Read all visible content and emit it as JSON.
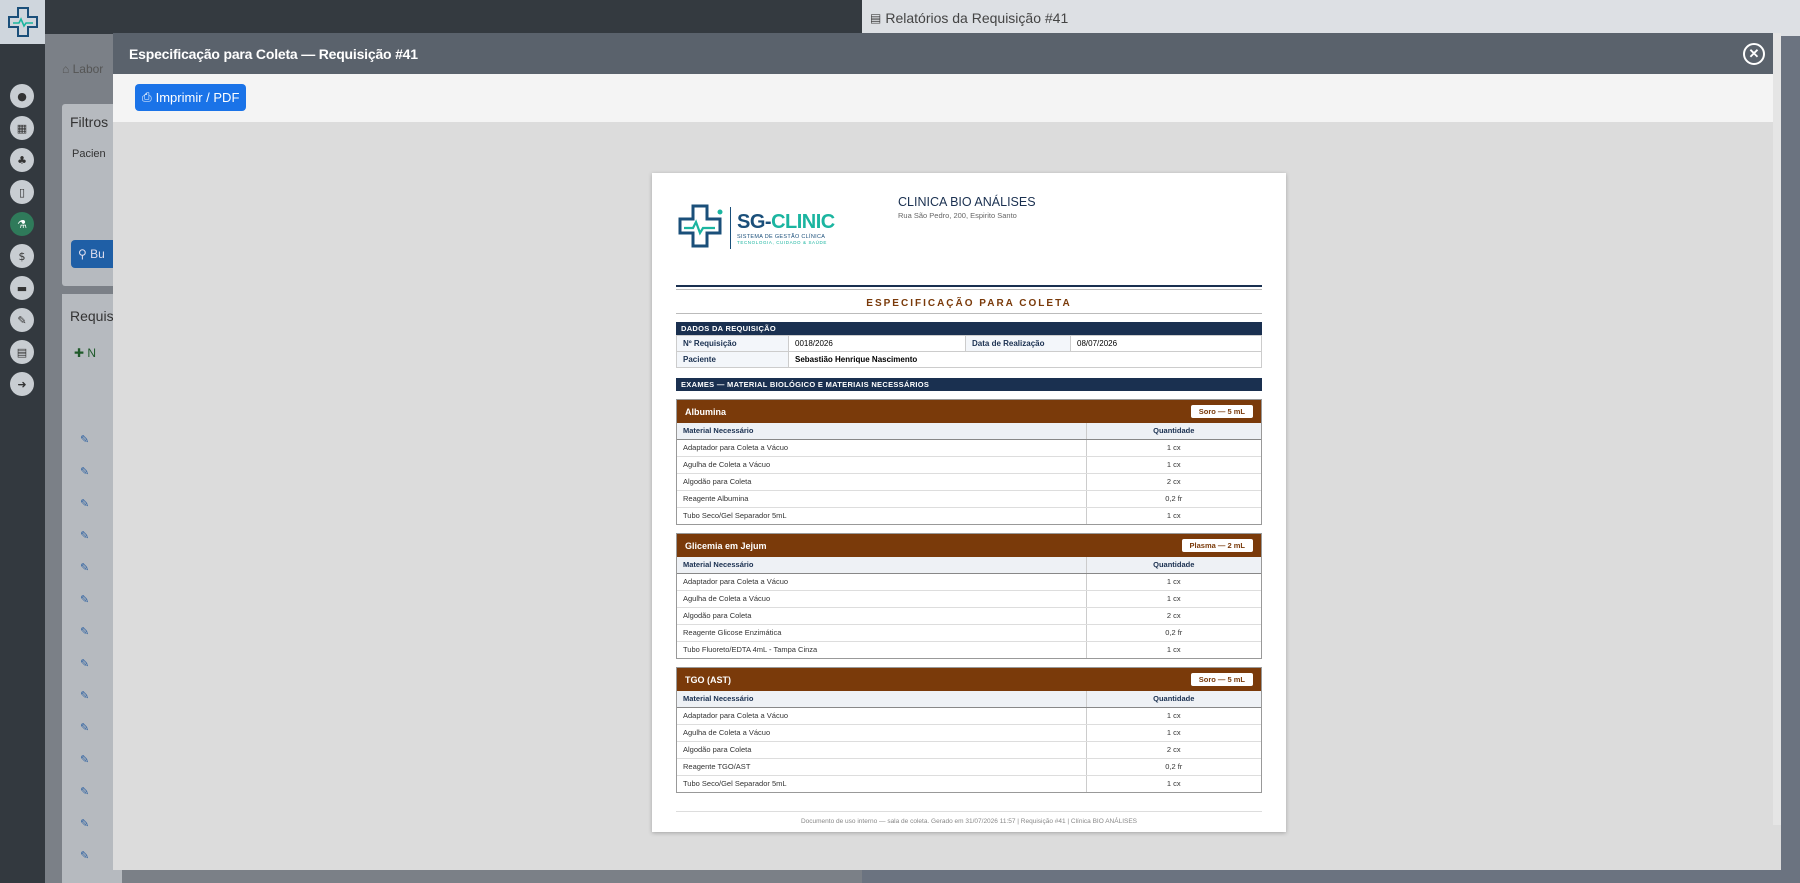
{
  "background": {
    "report_header": "Relatórios da Requisição #41",
    "breadcrumb": "Labor",
    "filters_title": "Filtros",
    "filter_label": "Pacien",
    "search_btn": "Bu",
    "list_title": "Requis",
    "new_btn": "N",
    "sidebar_icons": [
      "user-icon",
      "calendar-icon",
      "users-icon",
      "clipboard-icon",
      "microscope-icon",
      "dollar-icon",
      "archive-icon",
      "edit-icon",
      "file-icon",
      "logout-icon"
    ]
  },
  "modal": {
    "title": "Especificação para Coleta — Requisição #41",
    "close_icon": "close-icon",
    "print_label": "Imprimir / PDF"
  },
  "paper": {
    "clinic_name": "CLINICA BIO ANÁLISES",
    "clinic_address": "Rua São Pedro, 200, Espirito Santo",
    "logo": {
      "brand_a": "SG-",
      "brand_b": "CLINIC",
      "sub": "SISTEMA DE GESTÃO CLÍNICA",
      "tagline": "TECNOLOGIA, CUIDADO & SAÚDE"
    },
    "title": "ESPECIFICAÇÃO PARA COLETA",
    "req_section": "DADOS DA REQUISIÇÃO",
    "req": {
      "num_label": "Nº Requisição",
      "num_value": "0018/2026",
      "date_label": "Data de Realização",
      "date_value": "08/07/2026",
      "patient_label": "Paciente",
      "patient_value": "Sebastião Henrique Nascimento"
    },
    "exams_section": "EXAMES — MATERIAL BIOLÓGICO E MATERIAIS NECESSÁRIOS",
    "col_material": "Material Necessário",
    "col_qty": "Quantidade",
    "exams": [
      {
        "name": "Albumina",
        "sample": "Soro — 5 mL",
        "items": [
          {
            "m": "Adaptador para Coleta a Vácuo",
            "q": "1 cx"
          },
          {
            "m": "Agulha de Coleta a Vácuo",
            "q": "1 cx"
          },
          {
            "m": "Algodão para Coleta",
            "q": "2 cx"
          },
          {
            "m": "Reagente Albumina",
            "q": "0,2 fr"
          },
          {
            "m": "Tubo Seco/Gel Separador 5mL",
            "q": "1 cx"
          }
        ]
      },
      {
        "name": "Glicemia em Jejum",
        "sample": "Plasma — 2 mL",
        "items": [
          {
            "m": "Adaptador para Coleta a Vácuo",
            "q": "1 cx"
          },
          {
            "m": "Agulha de Coleta a Vácuo",
            "q": "1 cx"
          },
          {
            "m": "Algodão para Coleta",
            "q": "2 cx"
          },
          {
            "m": "Reagente Glicose Enzimática",
            "q": "0,2 fr"
          },
          {
            "m": "Tubo Fluoreto/EDTA 4mL - Tampa Cinza",
            "q": "1 cx"
          }
        ]
      },
      {
        "name": "TGO (AST)",
        "sample": "Soro — 5 mL",
        "items": [
          {
            "m": "Adaptador para Coleta a Vácuo",
            "q": "1 cx"
          },
          {
            "m": "Agulha de Coleta a Vácuo",
            "q": "1 cx"
          },
          {
            "m": "Algodão para Coleta",
            "q": "2 cx"
          },
          {
            "m": "Reagente TGO/AST",
            "q": "0,2 fr"
          },
          {
            "m": "Tubo Seco/Gel Separador 5mL",
            "q": "1 cx"
          }
        ]
      }
    ],
    "footer": "Documento de uso interno — sala de coleta. Gerado em 31/07/2026 11:57  |  Requisição #41  |  Clínica BIO ANÁLISES"
  },
  "colors": {
    "primary": "#1a73e8",
    "navy": "#1a3050",
    "exam_header": "#7a3a0a",
    "brand_teal": "#1bb5a0"
  }
}
